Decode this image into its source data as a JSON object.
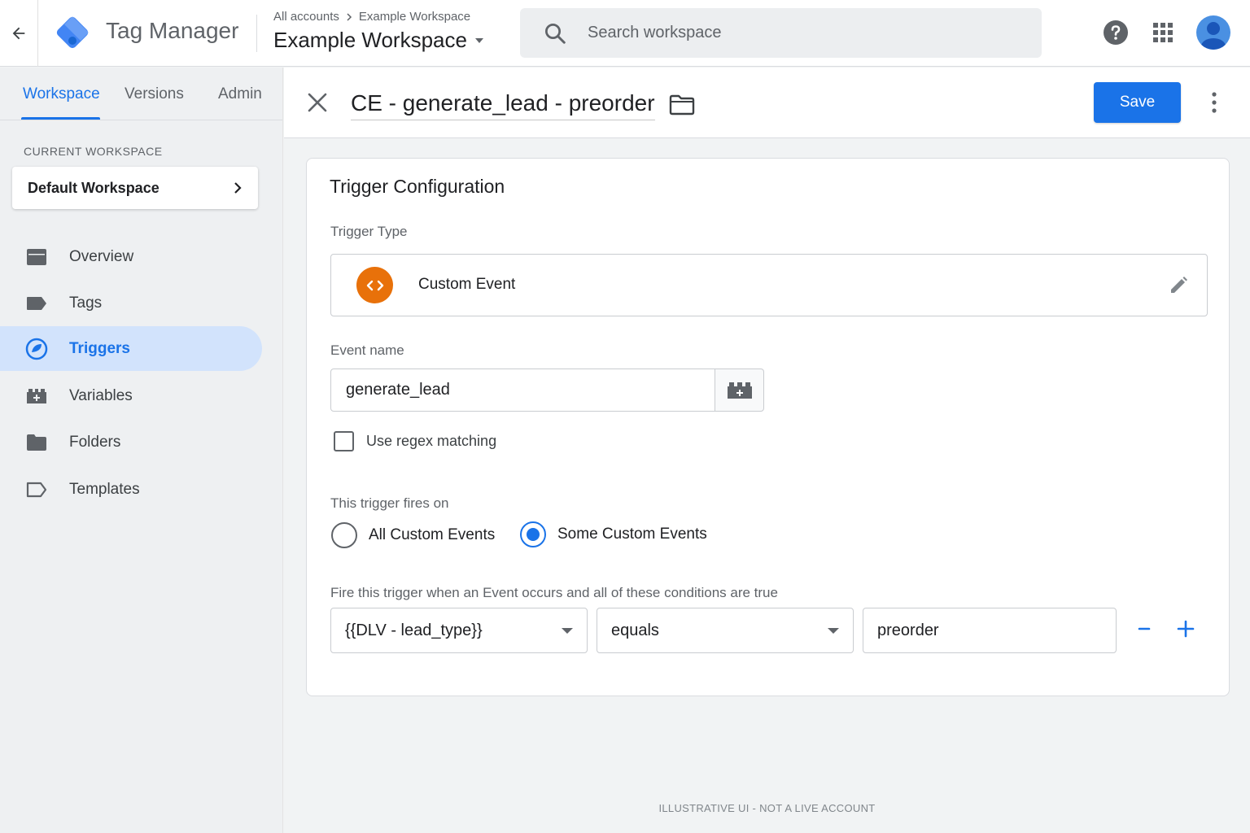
{
  "header": {
    "app_name": "Tag Manager",
    "breadcrumb": [
      "All accounts",
      "Example Workspace"
    ],
    "workspace_title": "Example Workspace",
    "search_placeholder": "Search workspace"
  },
  "sidebar": {
    "tabs": [
      {
        "label": "Workspace",
        "active": true
      },
      {
        "label": "Versions",
        "active": false
      },
      {
        "label": "Admin",
        "active": false
      }
    ],
    "current_workspace_label": "CURRENT WORKSPACE",
    "current_workspace": "Default Workspace",
    "items": [
      {
        "label": "Overview",
        "icon": "overview-icon"
      },
      {
        "label": "Tags",
        "icon": "tag-icon"
      },
      {
        "label": "Triggers",
        "icon": "trigger-icon",
        "active": true
      },
      {
        "label": "Variables",
        "icon": "variables-icon"
      },
      {
        "label": "Folders",
        "icon": "folder-icon"
      },
      {
        "label": "Templates",
        "icon": "template-icon"
      }
    ]
  },
  "editor": {
    "trigger_name": "CE - generate_lead - preorder",
    "save_label": "Save"
  },
  "config": {
    "title": "Trigger Configuration",
    "type_label": "Trigger Type",
    "type_value": "Custom Event",
    "event_name_label": "Event name",
    "event_name_value": "generate_lead",
    "regex_label": "Use regex matching",
    "regex_checked": false,
    "fires_on_label": "This trigger fires on",
    "fires_on_options": [
      "All Custom Events",
      "Some Custom Events"
    ],
    "fires_on_selected": "Some Custom Events",
    "condition_label": "Fire this trigger when an Event occurs and all of these conditions are true",
    "condition": {
      "variable": "{{DLV - lead_type}}",
      "operator": "equals",
      "value": "preorder"
    }
  },
  "colors": {
    "accent": "#1a73e8",
    "custom_event_badge": "#e8710a"
  },
  "footer_note": "ILLUSTRATIVE UI - NOT A LIVE ACCOUNT"
}
